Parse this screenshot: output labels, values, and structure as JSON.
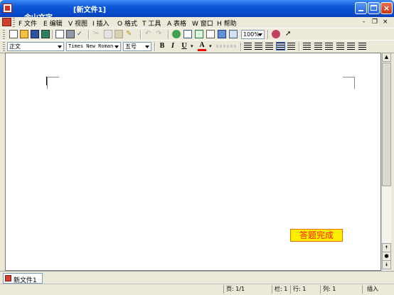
{
  "window": {
    "app_title": "金山文字",
    "separator": "—",
    "doc_title": "[新文件1]",
    "colors": {
      "title_gradient_top": "#3d8bf5",
      "title_gradient_bottom": "#0648c8",
      "close": "#c33a12"
    }
  },
  "menu": {
    "items": [
      {
        "label": "F 文件"
      },
      {
        "label": "E 编辑"
      },
      {
        "label": "V 视图"
      },
      {
        "label": "I 插入"
      },
      {
        "label": "O 格式"
      },
      {
        "label": "T 工具"
      },
      {
        "label": "A 表格"
      },
      {
        "label": "W 窗口"
      },
      {
        "label": "H 帮助"
      }
    ],
    "mdi_controls": [
      "-",
      "❐",
      "×"
    ]
  },
  "toolbar": {
    "zoom": "100%",
    "icons": [
      "new-icon",
      "open-icon",
      "save-icon",
      "save-as-icon",
      "print-preview-icon",
      "print-icon",
      "spellcheck-icon",
      "cut-icon",
      "copy-icon",
      "paste-icon",
      "format-painter-icon",
      "undo-icon",
      "redo-icon",
      "hyperlink-icon",
      "table-icon",
      "excel-icon",
      "columns-icon",
      "picture-icon",
      "chart-icon",
      "drawing-icon",
      "help-icon",
      "pointer-icon"
    ]
  },
  "format_bar": {
    "style": "正文",
    "font": "Times New Roman",
    "size": "五号",
    "bold": "B",
    "italic": "I",
    "underline": "U",
    "font_color": "A",
    "font_color_hex": "#ff0000"
  },
  "document": {
    "answer_button": "答题完成",
    "answer_button_colors": {
      "bg": "#ffee00",
      "text": "#ff2000"
    }
  },
  "tabs": [
    {
      "label": "新文件1"
    }
  ],
  "status": {
    "page": "页: 1/1",
    "section": "栏: 1",
    "line": "行: 1",
    "column": "列: 1",
    "mode": "插入"
  }
}
